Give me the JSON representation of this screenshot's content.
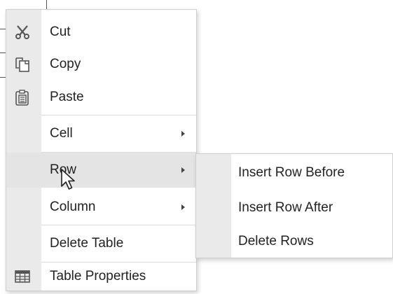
{
  "context_menu": {
    "items": [
      {
        "label": "Cut",
        "icon": "scissors-icon"
      },
      {
        "label": "Copy",
        "icon": "copy-icon"
      },
      {
        "label": "Paste",
        "icon": "paste-icon"
      },
      {
        "label": "Cell",
        "has_submenu": true
      },
      {
        "label": "Row",
        "has_submenu": true,
        "active": true
      },
      {
        "label": "Column",
        "has_submenu": true
      },
      {
        "label": "Delete Table"
      },
      {
        "label": "Table Properties",
        "icon": "table-icon"
      }
    ]
  },
  "row_submenu": {
    "items": [
      {
        "label": "Insert Row Before"
      },
      {
        "label": "Insert Row After"
      },
      {
        "label": "Delete Rows"
      }
    ]
  },
  "colors": {
    "gutter": "#eaeaea",
    "active_row": "#e4e4e4",
    "text": "#222222",
    "border": "#cfcfcf"
  },
  "cursor": "arrow-pointer-icon"
}
